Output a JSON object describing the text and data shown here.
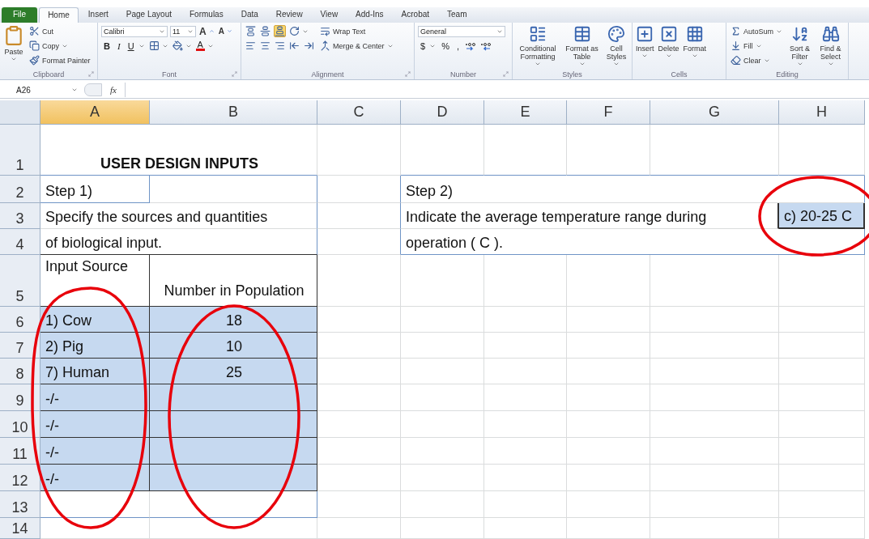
{
  "ribbon": {
    "tabs": [
      {
        "label": "File",
        "kind": "file",
        "selected": false
      },
      {
        "label": "Home",
        "kind": "tab",
        "selected": true
      },
      {
        "label": "Insert",
        "kind": "tab",
        "selected": false
      },
      {
        "label": "Page Layout",
        "kind": "tab",
        "selected": false
      },
      {
        "label": "Formulas",
        "kind": "tab",
        "selected": false
      },
      {
        "label": "Data",
        "kind": "tab",
        "selected": false
      },
      {
        "label": "Review",
        "kind": "tab",
        "selected": false
      },
      {
        "label": "View",
        "kind": "tab",
        "selected": false
      },
      {
        "label": "Add-Ins",
        "kind": "tab",
        "selected": false
      },
      {
        "label": "Acrobat",
        "kind": "tab",
        "selected": false
      },
      {
        "label": "Team",
        "kind": "tab",
        "selected": false
      }
    ],
    "groups": [
      {
        "label": "Clipboard",
        "launcher": true,
        "items": [
          {
            "kind": "paste",
            "label": "Paste",
            "dropdown": true
          },
          {
            "kind": "stack",
            "rows": [
              {
                "items": [
                  {
                    "kind": "cut",
                    "label": "Cut"
                  }
                ]
              },
              {
                "items": [
                  {
                    "kind": "copy",
                    "label": "Copy",
                    "dropdown": true
                  }
                ]
              },
              {
                "items": [
                  {
                    "kind": "painter",
                    "label": "Format Painter"
                  }
                ]
              }
            ]
          }
        ]
      },
      {
        "label": "Font",
        "launcher": true,
        "items": [
          {
            "kind": "stack",
            "rows": [
              {
                "items": [
                  {
                    "kind": "font-field",
                    "value": "Calibri"
                  },
                  {
                    "kind": "size-field",
                    "value": "11"
                  },
                  {
                    "kind": "grow",
                    "label": "A"
                  },
                  {
                    "kind": "shrink",
                    "label": "A"
                  }
                ]
              },
              {
                "items": [
                  {
                    "kind": "bold",
                    "label": "B"
                  },
                  {
                    "kind": "italic",
                    "label": "I"
                  },
                  {
                    "kind": "underline",
                    "label": "U",
                    "dropdown": true
                  },
                  {
                    "kind": "borders",
                    "dropdown": true
                  },
                  {
                    "kind": "fill-color",
                    "dropdown": true
                  },
                  {
                    "kind": "font-color",
                    "label": "A",
                    "dropdown": true
                  }
                ]
              }
            ]
          }
        ]
      },
      {
        "label": "Alignment",
        "launcher": true,
        "items": [
          {
            "kind": "stack",
            "rows": [
              {
                "items": [
                  {
                    "kind": "align-top",
                    "selected": false
                  },
                  {
                    "kind": "align-middle",
                    "selected": false
                  },
                  {
                    "kind": "align-bottom",
                    "selected": true
                  },
                  {
                    "kind": "orientation",
                    "dropdown": true
                  }
                ]
              },
              {
                "items": [
                  {
                    "kind": "align-left",
                    "selected": false
                  },
                  {
                    "kind": "align-center",
                    "selected": false
                  },
                  {
                    "kind": "align-right",
                    "selected": false
                  },
                  {
                    "kind": "outdent"
                  },
                  {
                    "kind": "indent"
                  }
                ]
              }
            ]
          },
          {
            "kind": "stack",
            "rows": [
              {
                "items": [
                  {
                    "kind": "wrap",
                    "label": "Wrap Text"
                  }
                ]
              },
              {
                "items": [
                  {
                    "kind": "merge",
                    "label": "Merge & Center",
                    "dropdown": true
                  }
                ]
              }
            ]
          }
        ]
      },
      {
        "label": "Number",
        "launcher": true,
        "items": [
          {
            "kind": "stack",
            "rows": [
              {
                "items": [
                  {
                    "kind": "format-field",
                    "value": "General"
                  }
                ]
              },
              {
                "items": [
                  {
                    "kind": "currency",
                    "label": "$",
                    "dropdown": true
                  },
                  {
                    "kind": "percent",
                    "label": "%"
                  },
                  {
                    "kind": "comma",
                    "label": ","
                  },
                  {
                    "kind": "decimal-more"
                  },
                  {
                    "kind": "decimal-less"
                  }
                ]
              }
            ]
          }
        ]
      },
      {
        "label": "Styles",
        "items": [
          {
            "kind": "conditional",
            "label": "Conditional Formatting",
            "dropdown": true
          },
          {
            "kind": "table",
            "label": "Format as Table",
            "dropdown": true
          },
          {
            "kind": "cell-styles",
            "label": "Cell Styles",
            "dropdown": true
          }
        ]
      },
      {
        "label": "Cells",
        "items": [
          {
            "kind": "insert",
            "label": "Insert",
            "dropdown": true
          },
          {
            "kind": "delete",
            "label": "Delete",
            "dropdown": true
          },
          {
            "kind": "format",
            "label": "Format",
            "dropdown": true
          }
        ]
      },
      {
        "label": "Editing",
        "items": [
          {
            "kind": "stack",
            "rows": [
              {
                "items": [
                  {
                    "kind": "autosum",
                    "label": "AutoSum",
                    "dropdown": true
                  }
                ]
              },
              {
                "items": [
                  {
                    "kind": "fill",
                    "label": "Fill",
                    "dropdown": true
                  }
                ]
              },
              {
                "items": [
                  {
                    "kind": "clear",
                    "label": "Clear",
                    "dropdown": true
                  }
                ]
              }
            ]
          },
          {
            "kind": "sort",
            "label": "Sort & Filter",
            "dropdown": true
          },
          {
            "kind": "find",
            "label": "Find & Select",
            "dropdown": true
          }
        ]
      }
    ]
  },
  "formula_bar": {
    "name_box": "A26",
    "function_label": "fx"
  },
  "sheet": {
    "columns": [
      {
        "label": "A",
        "selected": true
      },
      {
        "label": "B",
        "selected": false
      },
      {
        "label": "C",
        "selected": false
      },
      {
        "label": "D",
        "selected": false
      },
      {
        "label": "E",
        "selected": false
      },
      {
        "label": "F",
        "selected": false
      },
      {
        "label": "G",
        "selected": false
      },
      {
        "label": "H",
        "selected": false
      }
    ],
    "rows": [
      {
        "number": "1",
        "cells": [
          {
            "text": "USER DESIGN INPUTS",
            "bold": true,
            "centered": true,
            "merged": true,
            "highlighted": false
          },
          {
            "highlighted": false
          },
          {
            "highlighted": false
          },
          {
            "highlighted": false
          },
          {
            "highlighted": false
          },
          {
            "highlighted": false
          },
          {
            "highlighted": false
          }
        ]
      },
      {
        "number": "2",
        "cells": [
          {
            "text": "Step 1)",
            "highlighted": false
          },
          {
            "highlighted": false
          },
          {
            "highlighted": false
          },
          {
            "text": "Step 2)",
            "highlighted": false
          },
          {
            "highlighted": false
          },
          {
            "highlighted": false
          },
          {
            "highlighted": false
          },
          {
            "highlighted": false
          }
        ]
      },
      {
        "number": "3",
        "cells": [
          {
            "text": "Specify the sources and quantities",
            "highlighted": false
          },
          {
            "highlighted": false
          },
          {
            "highlighted": false
          },
          {
            "text": "Indicate the average temperature range during",
            "highlighted": false
          },
          {
            "highlighted": false
          },
          {
            "highlighted": false
          },
          {
            "highlighted": false
          },
          {
            "text": "c) 20-25 C",
            "highlighted": true
          }
        ]
      },
      {
        "number": "4",
        "cells": [
          {
            "text": "of biological input.",
            "highlighted": false
          },
          {
            "highlighted": false
          },
          {
            "highlighted": false
          },
          {
            "text": "operation ( C ).",
            "highlighted": false
          },
          {
            "highlighted": false
          },
          {
            "highlighted": false
          },
          {
            "highlighted": false
          },
          {
            "highlighted": false
          }
        ]
      },
      {
        "number": "5",
        "cells": [
          {
            "text": "Input Source",
            "top_aligned": true,
            "highlighted": false
          },
          {
            "text": "Number in Population",
            "centered": true,
            "wrapped": true,
            "highlighted": false
          },
          {
            "highlighted": false
          },
          {
            "highlighted": false
          },
          {
            "highlighted": false
          },
          {
            "highlighted": false
          },
          {
            "highlighted": false
          },
          {
            "highlighted": false
          }
        ]
      },
      {
        "number": "6",
        "cells": [
          {
            "text": "1) Cow",
            "highlighted": true
          },
          {
            "text": "18",
            "centered": true,
            "highlighted": true
          },
          {
            "highlighted": false
          },
          {
            "highlighted": false
          },
          {
            "highlighted": false
          },
          {
            "highlighted": false
          },
          {
            "highlighted": false
          },
          {
            "highlighted": false
          }
        ]
      },
      {
        "number": "7",
        "cells": [
          {
            "text": "2) Pig",
            "highlighted": true
          },
          {
            "text": "10",
            "centered": true,
            "highlighted": true
          },
          {
            "highlighted": false
          },
          {
            "highlighted": false
          },
          {
            "highlighted": false
          },
          {
            "highlighted": false
          },
          {
            "highlighted": false
          },
          {
            "highlighted": false
          }
        ]
      },
      {
        "number": "8",
        "cells": [
          {
            "text": "7) Human",
            "highlighted": true
          },
          {
            "text": "25",
            "centered": true,
            "highlighted": true
          },
          {
            "highlighted": false
          },
          {
            "highlighted": false
          },
          {
            "highlighted": false
          },
          {
            "highlighted": false
          },
          {
            "highlighted": false
          },
          {
            "highlighted": false
          }
        ]
      },
      {
        "number": "9",
        "cells": [
          {
            "text": "-/-",
            "highlighted": true
          },
          {
            "highlighted": true
          },
          {
            "highlighted": false
          },
          {
            "highlighted": false
          },
          {
            "highlighted": false
          },
          {
            "highlighted": false
          },
          {
            "highlighted": false
          },
          {
            "highlighted": false
          }
        ]
      },
      {
        "number": "10",
        "cells": [
          {
            "text": "-/-",
            "highlighted": true
          },
          {
            "highlighted": true
          },
          {
            "highlighted": false
          },
          {
            "highlighted": false
          },
          {
            "highlighted": false
          },
          {
            "highlighted": false
          },
          {
            "highlighted": false
          },
          {
            "highlighted": false
          }
        ]
      },
      {
        "number": "11",
        "cells": [
          {
            "text": "-/-",
            "highlighted": true
          },
          {
            "highlighted": true
          },
          {
            "highlighted": false
          },
          {
            "highlighted": false
          },
          {
            "highlighted": false
          },
          {
            "highlighted": false
          },
          {
            "highlighted": false
          },
          {
            "highlighted": false
          }
        ]
      },
      {
        "number": "12",
        "cells": [
          {
            "text": "-/-",
            "highlighted": true
          },
          {
            "highlighted": true
          },
          {
            "highlighted": false
          },
          {
            "highlighted": false
          },
          {
            "highlighted": false
          },
          {
            "highlighted": false
          },
          {
            "highlighted": false
          },
          {
            "highlighted": false
          }
        ]
      },
      {
        "number": "13",
        "cells": [
          {
            "highlighted": false
          },
          {
            "highlighted": false
          },
          {
            "highlighted": false
          },
          {
            "highlighted": false
          },
          {
            "highlighted": false
          },
          {
            "highlighted": false
          },
          {
            "highlighted": false
          },
          {
            "highlighted": false
          }
        ]
      },
      {
        "number": "14",
        "cells": [
          {
            "highlighted": false
          },
          {
            "highlighted": false
          },
          {
            "highlighted": false
          },
          {
            "highlighted": false
          },
          {
            "highlighted": false
          },
          {
            "highlighted": false
          },
          {
            "highlighted": false
          },
          {
            "highlighted": false
          }
        ]
      }
    ]
  },
  "annotations": [
    {
      "kind": "ellipse",
      "color": "#e8000b"
    },
    {
      "kind": "ellipse",
      "color": "#e8000b"
    },
    {
      "kind": "ellipse",
      "color": "#e8000b"
    }
  ]
}
